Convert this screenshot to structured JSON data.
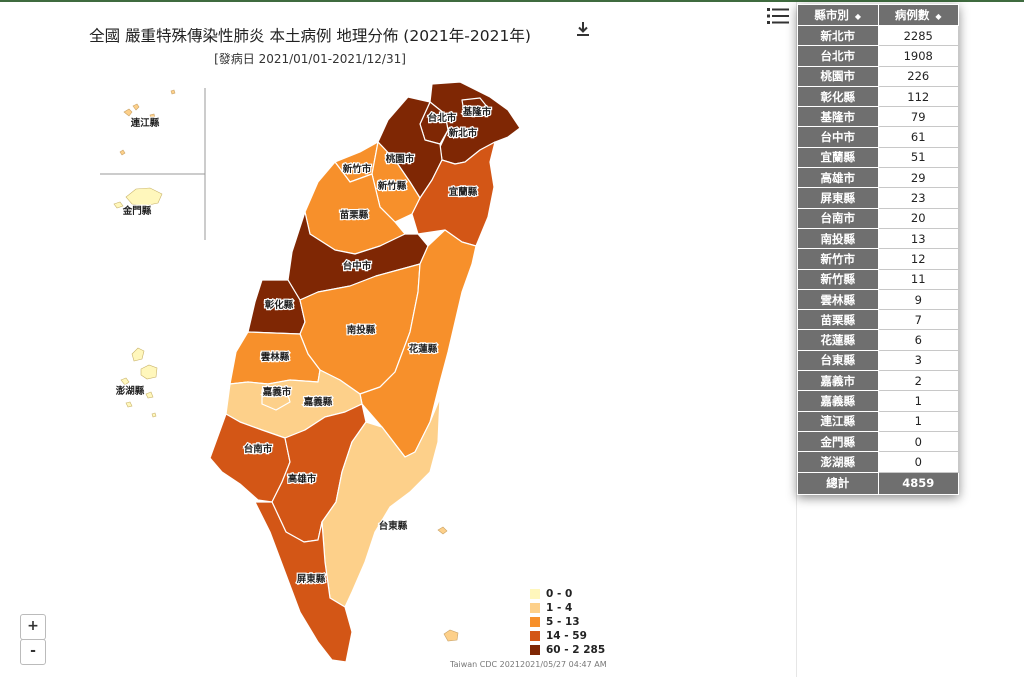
{
  "title": "全國 嚴重特殊傳染性肺炎 本土病例 地理分佈 (2021年-2021年)",
  "subtitle": "[發病日 2021/01/01-2021/12/31]",
  "credit": "Taiwan CDC 20212021/05/27 04:47 AM",
  "zoom": {
    "in": "+",
    "out": "-"
  },
  "icons": {
    "download": "download-icon",
    "menu": "hamburger-menu-icon",
    "sort": "sort-arrows-icon"
  },
  "legend": [
    {
      "label": "0 - 0",
      "color": "#fff7bc"
    },
    {
      "label": "1 - 4",
      "color": "#fdd08a"
    },
    {
      "label": "5 - 13",
      "color": "#f7902b"
    },
    {
      "label": "14 - 59",
      "color": "#d35616"
    },
    {
      "label": "60 - 2 285",
      "color": "#7f2704"
    }
  ],
  "map_labels": {
    "lienchiang": "連江縣",
    "kinmen": "金門縣",
    "penghu": "澎湖縣",
    "taipei": "台北市",
    "keelung": "基隆市",
    "newtaipei": "新北市",
    "taoyuan": "桃園市",
    "hsinchucity": "新竹市",
    "hsinchucounty": "新竹縣",
    "yilan": "宜蘭縣",
    "miaoli": "苗栗縣",
    "taichung": "台中市",
    "changhua": "彰化縣",
    "nantou": "南投縣",
    "hualien": "花蓮縣",
    "yunlin": "雲林縣",
    "chiayicity": "嘉義市",
    "chiayicounty": "嘉義縣",
    "tainan": "台南市",
    "kaohsiung": "高雄市",
    "taitung": "台東縣",
    "pingtung": "屏東縣"
  },
  "table": {
    "header_city": "縣市別",
    "header_cases": "病例數",
    "rows": [
      {
        "city": "新北市",
        "cases": "2285"
      },
      {
        "city": "台北市",
        "cases": "1908"
      },
      {
        "city": "桃園市",
        "cases": "226"
      },
      {
        "city": "彰化縣",
        "cases": "112"
      },
      {
        "city": "基隆市",
        "cases": "79"
      },
      {
        "city": "台中市",
        "cases": "61"
      },
      {
        "city": "宜蘭縣",
        "cases": "51"
      },
      {
        "city": "高雄市",
        "cases": "29"
      },
      {
        "city": "屏東縣",
        "cases": "23"
      },
      {
        "city": "台南市",
        "cases": "20"
      },
      {
        "city": "南投縣",
        "cases": "13"
      },
      {
        "city": "新竹市",
        "cases": "12"
      },
      {
        "city": "新竹縣",
        "cases": "11"
      },
      {
        "city": "雲林縣",
        "cases": "9"
      },
      {
        "city": "苗栗縣",
        "cases": "7"
      },
      {
        "city": "花蓮縣",
        "cases": "6"
      },
      {
        "city": "台東縣",
        "cases": "3"
      },
      {
        "city": "嘉義市",
        "cases": "2"
      },
      {
        "city": "嘉義縣",
        "cases": "1"
      },
      {
        "city": "連江縣",
        "cases": "1"
      },
      {
        "city": "金門縣",
        "cases": "0"
      },
      {
        "city": "澎湖縣",
        "cases": "0"
      }
    ],
    "total_label": "總計",
    "total_value": "4859"
  }
}
